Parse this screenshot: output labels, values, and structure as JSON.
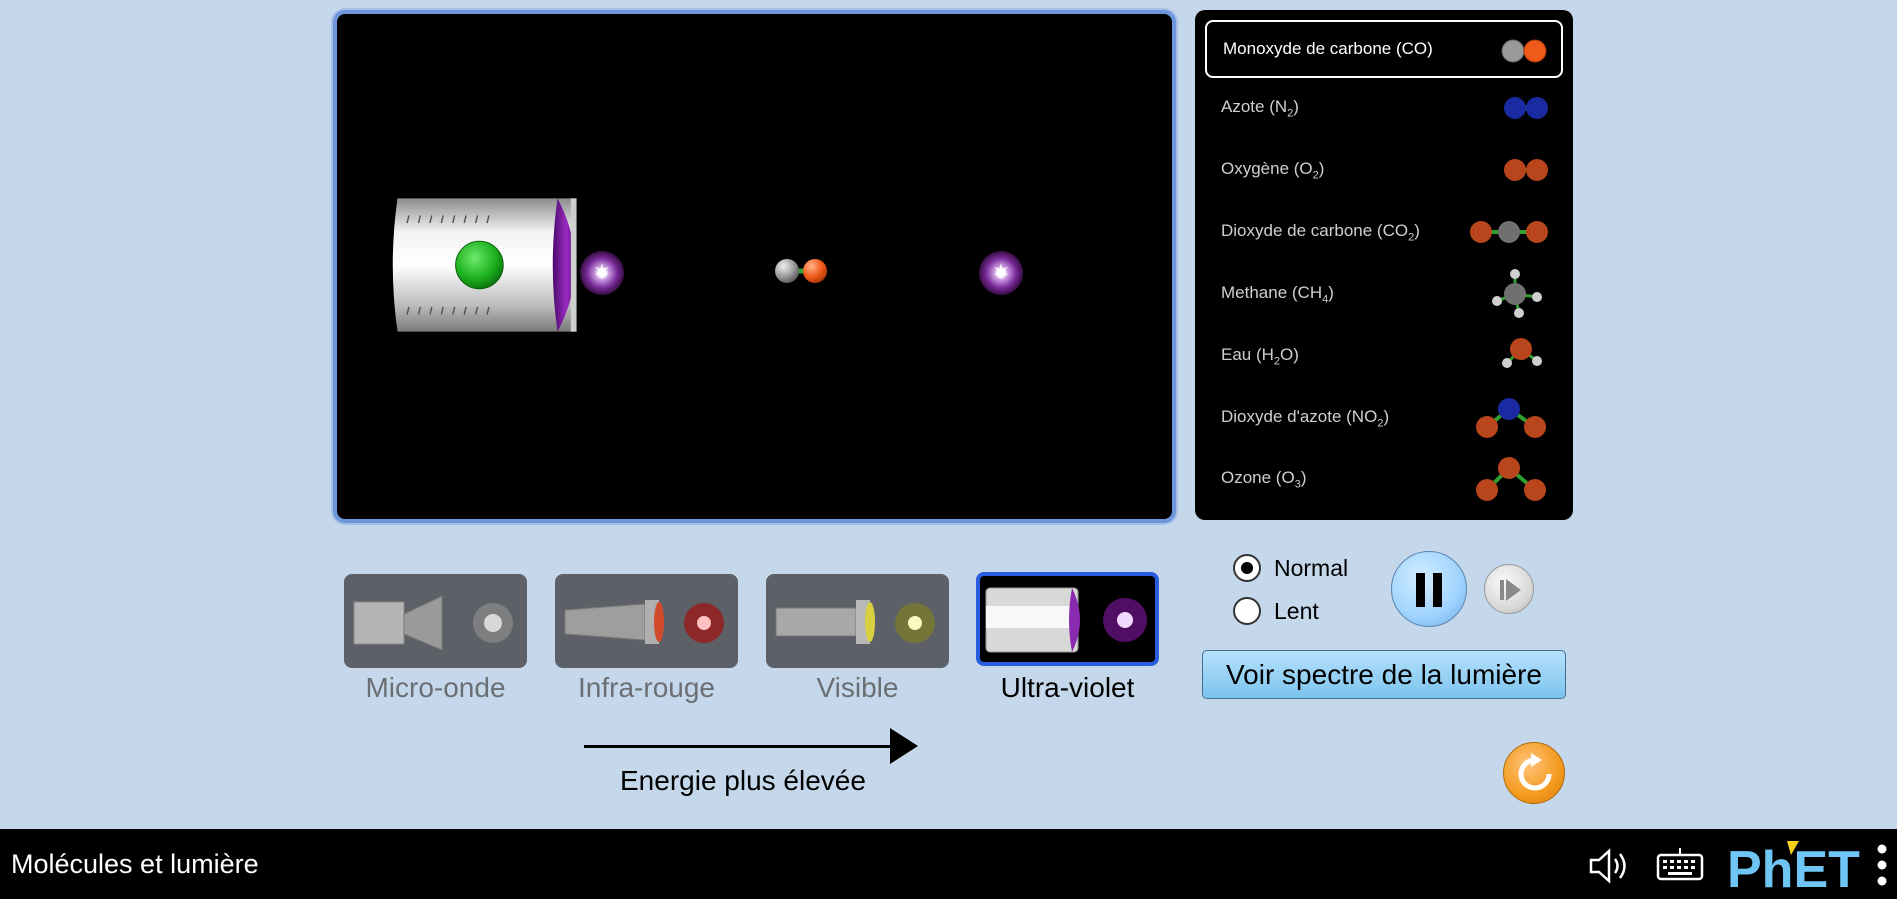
{
  "molecules": {
    "items": [
      {
        "label": "Monoxyde de carbone (CO)",
        "selected": true
      },
      {
        "label_pre": "Azote (N",
        "sub": "2",
        "label_post": ")"
      },
      {
        "label_pre": "Oxygène (O",
        "sub": "2",
        "label_post": ")"
      },
      {
        "label_pre": "Dioxyde de carbone (CO",
        "sub": "2",
        "label_post": ")"
      },
      {
        "label_pre": "Methane (CH",
        "sub": "4",
        "label_post": ")"
      },
      {
        "label_pre": "Eau (H",
        "sub": "2",
        "label_post": "O)"
      },
      {
        "label_pre": "Dioxyde d'azote (NO",
        "sub": "2",
        "label_post": ")"
      },
      {
        "label_pre": "Ozone (O",
        "sub": "3",
        "label_post": ")"
      }
    ]
  },
  "light_sources": {
    "items": [
      {
        "label": "Micro-onde"
      },
      {
        "label": "Infra-rouge"
      },
      {
        "label": "Visible"
      },
      {
        "label": "Ultra-violet",
        "selected": true
      }
    ],
    "energy_label": "Energie plus élevée"
  },
  "speed": {
    "normal_label": "Normal",
    "slow_label": "Lent",
    "selected": "Normal"
  },
  "spectrum_button_label": "Voir spectre de la lumière",
  "navbar": {
    "title": "Molécules et lumière",
    "brand": "PhET"
  },
  "colors": {
    "background": "#c5d8eb",
    "play_border": "#6e96dc",
    "selected_source_border": "#2a5ce0",
    "carbon": "#8a8a8a",
    "oxygen": "#e8541c",
    "nitrogen": "#1a2aa0",
    "uv_photon": "#7a2a9a",
    "reset": "#f39a1e"
  }
}
